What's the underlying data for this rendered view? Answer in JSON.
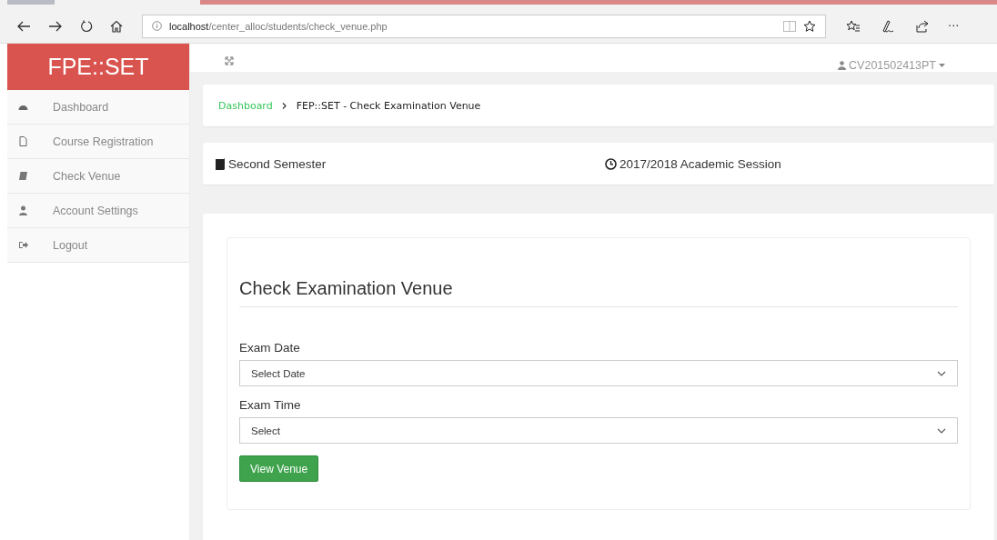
{
  "browser": {
    "url_host": "localhost",
    "url_path": "/center_alloc/students/check_venue.php",
    "more": "···"
  },
  "brand": "FPE::SET",
  "user": "CV201502413PT",
  "sidebar": {
    "items": [
      {
        "label": "Dashboard"
      },
      {
        "label": "Course Registration"
      },
      {
        "label": "Check Venue"
      },
      {
        "label": "Account Settings"
      },
      {
        "label": "Logout"
      }
    ]
  },
  "breadcrumb": {
    "link": "Dashboard",
    "current": "FEP::SET - Check Examination Venue"
  },
  "info": {
    "semester": "Second Semester",
    "session": "2017/2018 Academic Session"
  },
  "form": {
    "title": "Check Examination Venue",
    "fields": [
      {
        "label": "Exam Date",
        "placeholder": "Select Date"
      },
      {
        "label": "Exam Time",
        "placeholder": "Select"
      }
    ],
    "button": "View Venue"
  }
}
